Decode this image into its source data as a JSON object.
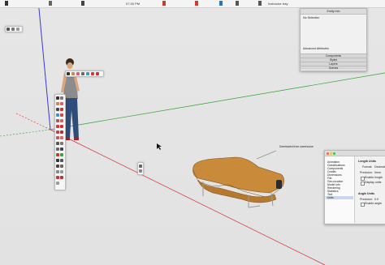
{
  "menubar": {
    "clock": "07:30 PM",
    "search_label": "Instructor tray"
  },
  "entity_info": {
    "title": "Entity Info",
    "status": "No Selection",
    "footer_label": "Advanced Attributes"
  },
  "tray_sections": [
    "Components",
    "Styles",
    "Layers",
    "Scenes"
  ],
  "callout": {
    "text": "Deeritaded from warehouse"
  },
  "prefs": {
    "list": [
      "Animation",
      "Classifications",
      "Components",
      "Credits",
      "Dimensions",
      "File",
      "Geo-location",
      "Model Info",
      "Rendering",
      "Statistics",
      "Text",
      "Units"
    ],
    "selected_index": 11,
    "length_title": "Length Units",
    "format_label": "Format:",
    "format_value": "Decimal",
    "precision_label": "Precision:",
    "precision_value": "0mm",
    "enable_length": "Enable length",
    "display_units": "Display units",
    "angle_title": "Angle Units",
    "angle_precision_label": "Precision:",
    "angle_precision_value": "0.0",
    "enable_angle": "Enable angle"
  },
  "colors": {
    "red_axis": "#d02a2a",
    "green_axis": "#2fa12f",
    "blue_axis": "#3b3bd6",
    "wood": "#c98b3a"
  }
}
